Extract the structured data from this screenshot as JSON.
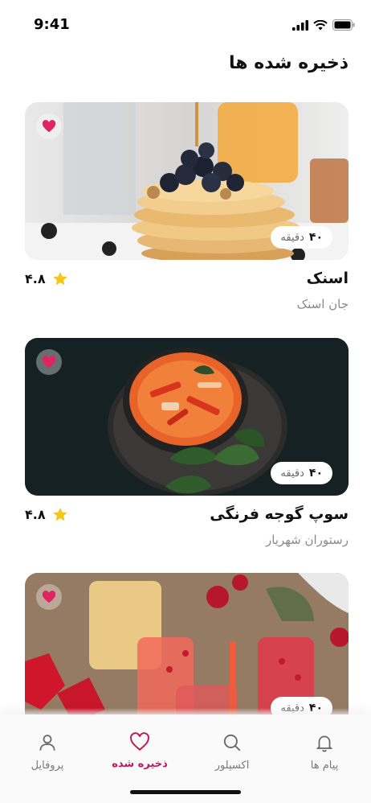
{
  "status_bar": {
    "time": "9:41"
  },
  "page": {
    "title": "ذخیره شده ها"
  },
  "cards": [
    {
      "name": "اسنک",
      "place": "جان اسنک",
      "rating": "۴.۸",
      "time_value": "۴۰",
      "time_unit": "دقیقه",
      "image": "pancakes-photo",
      "favorited": true
    },
    {
      "name": "سوپ گوجه فرنگی",
      "place": "رستوران شهریار",
      "rating": "۴.۸",
      "time_value": "۴۰",
      "time_unit": "دقیقه",
      "image": "tomato-soup-photo",
      "favorited": true
    },
    {
      "name": "",
      "place": "",
      "rating": "",
      "time_value": "۴۰",
      "time_unit": "دقیقه",
      "image": "drinks-photo",
      "favorited": true
    }
  ],
  "nav": {
    "items": [
      {
        "label": "پروفایل",
        "icon": "user-icon",
        "active": false
      },
      {
        "label": "ذخیره شده",
        "icon": "heart-icon",
        "active": true
      },
      {
        "label": "اکسپلور",
        "icon": "search-icon",
        "active": false
      },
      {
        "label": "پیام ها",
        "icon": "bell-icon",
        "active": false
      }
    ]
  },
  "colors": {
    "accent": "#c2185b",
    "favorite": "#e0245e",
    "star": "#f5c518"
  }
}
